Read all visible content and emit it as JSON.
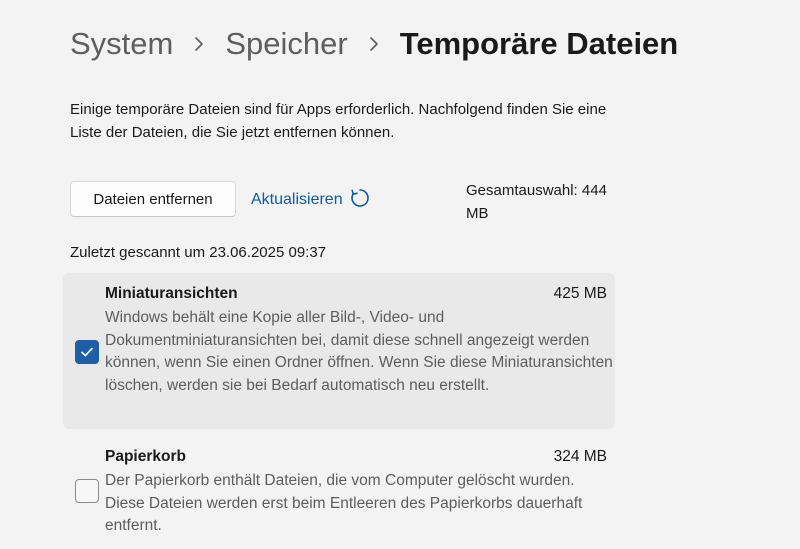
{
  "breadcrumb": {
    "items": [
      "System",
      "Speicher"
    ],
    "current": "Temporäre Dateien"
  },
  "description": "Einige temporäre Dateien sind für Apps erforderlich. Nachfolgend finden Sie eine Liste der Dateien, die Sie jetzt entfernen können.",
  "actions": {
    "remove_label": "Dateien entfernen",
    "refresh_label": "Aktualisieren",
    "refresh_icon": "refresh-icon"
  },
  "total_selection": "Gesamtauswahl: 444 MB",
  "last_scanned": "Zuletzt gescannt um 23.06.2025 09:37",
  "items": [
    {
      "title": "Miniaturansichten",
      "size": "425 MB",
      "description": "Windows behält eine Kopie aller Bild-, Video- und Dokumentminiaturansichten bei, damit diese schnell angezeigt werden können, wenn Sie einen Ordner öffnen. Wenn Sie diese Miniaturansichten löschen, werden sie bei Bedarf automatisch neu erstellt.",
      "checked": true
    },
    {
      "title": "Papierkorb",
      "size": "324 MB",
      "description": "Der Papierkorb enthält Dateien, die vom Computer gelöscht wurden. Diese Dateien werden erst beim Entleeren des Papierkorbs dauerhaft entfernt.",
      "checked": false
    }
  ],
  "colors": {
    "accent": "#1f5fa8",
    "link": "#0a5cab",
    "background": "#f3f3f3",
    "selected_item_bg": "#e9e9e9"
  }
}
